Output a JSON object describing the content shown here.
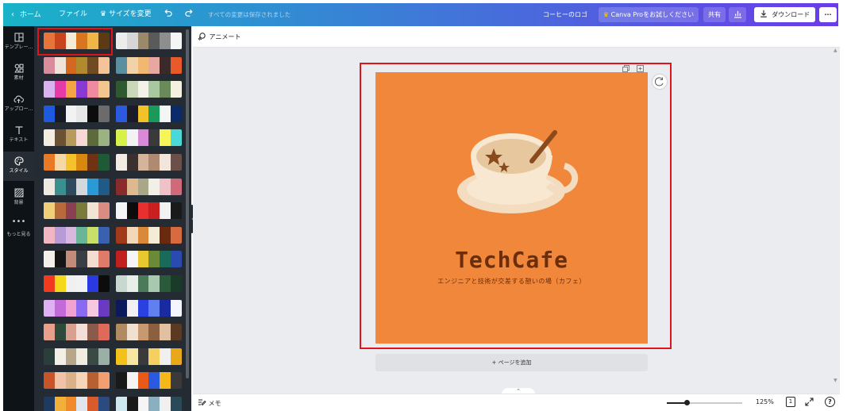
{
  "topbar": {
    "home": "ホーム",
    "file": "ファイル",
    "resize": "サイズを変更",
    "save_status": "すべての変更は保存されました",
    "doc_title": "コーヒーのロゴ",
    "pro_button": "Canva Proをお試しください",
    "share": "共有",
    "download": "ダウンロード",
    "more": "···"
  },
  "rail": {
    "items": [
      {
        "label": "テンプレー...",
        "icon": "template-icon"
      },
      {
        "label": "素材",
        "icon": "elements-icon"
      },
      {
        "label": "アップロー...",
        "icon": "upload-cloud-icon"
      },
      {
        "label": "テキスト",
        "icon": "text-icon"
      },
      {
        "label": "スタイル",
        "icon": "palette-icon",
        "active": true
      },
      {
        "label": "背景",
        "icon": "background-icon"
      },
      {
        "label": "もっと見る",
        "icon": "more-icon"
      }
    ]
  },
  "palettes": {
    "left": [
      [
        "#e8743a",
        "#c9431f",
        "#f4ecd6",
        "#d9751f",
        "#f0b547",
        "#5e3a12"
      ],
      [
        "#d98c9b",
        "#f0e4d8",
        "#d4681f",
        "#b08a2c",
        "#6f4a22",
        "#f5c39a"
      ],
      [
        "#d9b3f0",
        "#e63aa8",
        "#f2a542",
        "#8a3ad4",
        "#f08aa0",
        "#f5c590"
      ],
      [
        "#1e5ae0",
        "#151a24",
        "#f2f2f2",
        "#e6e6e6",
        "#0c0c0c",
        "#6b6b6b"
      ],
      [
        "#f4ede0",
        "#6a5233",
        "#b79a5c",
        "#f6d9d4",
        "#5d6a3a",
        "#9bb382"
      ],
      [
        "#e87a25",
        "#f5d8a6",
        "#f4c32c",
        "#d9880f",
        "#6e3313",
        "#1f5a36"
      ],
      [
        "#eeeae2",
        "#3a8f8f",
        "#2f4a60",
        "#d4d8dc",
        "#2a9ad6",
        "#1f5a88"
      ],
      [
        "#f0cf7a",
        "#b86a3a",
        "#8a3f52",
        "#7a7a3a",
        "#f2e4d4",
        "#d98c82"
      ],
      [
        "#f0b6c2",
        "#b89ad6",
        "#d9b8e0",
        "#6ab49a",
        "#c8e06a",
        "#3a60b0"
      ],
      [
        "#f2f0e8",
        "#151515",
        "#c28b7a",
        "#3a3f46",
        "#f2ddd0",
        "#e07a6a"
      ],
      [
        "#f23a1f",
        "#f5d81a",
        "#f0f0f0",
        "#f2f2f2",
        "#2a3ae0",
        "#0c0c0c"
      ],
      [
        "#e0b0f5",
        "#c26ad9",
        "#f2a2d0",
        "#8a6af0",
        "#f5c8e0",
        "#6a3ac2"
      ],
      [
        "#e8a08c",
        "#2f4a3a",
        "#d9a090",
        "#f2e0d8",
        "#8a5a4a",
        "#e06a5a"
      ],
      [
        "#2a3f3a",
        "#f2f0e6",
        "#b8a68a",
        "#f0ece0",
        "#3a4a44",
        "#9ab0a6"
      ],
      [
        "#c8552a",
        "#f0c2a8",
        "#d9b28a",
        "#f5d6b8",
        "#b86030",
        "#f0a070"
      ],
      [
        "#1f3a60",
        "#f2b03a",
        "#f08a2a",
        "#e0e6ee",
        "#d95a2a",
        "#2a4a80"
      ]
    ],
    "right": [
      [
        "#ececec",
        "#d6d6d6",
        "#9a8a6a",
        "#5a5a5a",
        "#8e8e8e",
        "#f5f5f5"
      ],
      [
        "#5a8fa0",
        "#f2d2a8",
        "#f0b870",
        "#e6a8a0",
        "#3a2a2a",
        "#e85a2a"
      ],
      [
        "#2f5a2f",
        "#c8d8b8",
        "#f2f2e8",
        "#a8c8a0",
        "#6a8a5a",
        "#f5f0e0"
      ],
      [
        "#2a5ae0",
        "#1a1a2a",
        "#f2c22a",
        "#1a9a5a",
        "#f5f5f5",
        "#0a2a6a"
      ],
      [
        "#d8f04a",
        "#f2f2f2",
        "#d88ad8",
        "#3a3a3a",
        "#f5f55a",
        "#4ad8d8"
      ],
      [
        "#f2ece4",
        "#3a3030",
        "#d4b49a",
        "#b08a70",
        "#f2e6dc",
        "#6a5048"
      ],
      [
        "#8a2a2a",
        "#e0b890",
        "#a8a888",
        "#f0f0e8",
        "#f0c2c8",
        "#d06a7a"
      ],
      [
        "#f5f5f5",
        "#0c0c0c",
        "#e83030",
        "#c82020",
        "#f2f2f2",
        "#1a1a1a"
      ],
      [
        "#a03a1a",
        "#f2d8b8",
        "#d88a3a",
        "#f5ecd8",
        "#6a2a10",
        "#d86a40"
      ],
      [
        "#c02020",
        "#f5f5f5",
        "#e8c830",
        "#6a8a3a",
        "#1a6a5a",
        "#2a4ab0"
      ],
      [
        "#c8d8d0",
        "#e8eee8",
        "#4a7a5a",
        "#a8c8b0",
        "#2a5a3a",
        "#1a3a2a"
      ],
      [
        "#0a1a5a",
        "#f0f0f5",
        "#2a40e0",
        "#6080f0",
        "#1a2aa0",
        "#f5f5ff"
      ],
      [
        "#b08a60",
        "#f0e0d0",
        "#c89870",
        "#8a6040",
        "#e0c0a0",
        "#5a3a20"
      ],
      [
        "#f2c21a",
        "#f5e6a0",
        "#3a3a3a",
        "#f5d060",
        "#f0f0f0",
        "#e8a81a"
      ],
      [
        "#1a1a1a",
        "#f5f5f5",
        "#e85a1a",
        "#2a5ae0",
        "#f5b81a",
        "#3a3a3a"
      ],
      [
        "#d0e8f0",
        "#1a1a1a",
        "#f5f5f5",
        "#8ab0c0",
        "#f0f0f0",
        "#2a4a5a"
      ]
    ]
  },
  "toolbar": {
    "animate": "アニメート"
  },
  "design": {
    "title": "TechCafe",
    "subtitle": "エンジニアと技術が交差する憩いの場（カフェ）",
    "background": "#f0873a"
  },
  "canvas": {
    "add_page": "+ ページを追加"
  },
  "bottombar": {
    "notes": "メモ",
    "zoom_value": 0.26,
    "zoom": "125%",
    "page_count": "1"
  }
}
